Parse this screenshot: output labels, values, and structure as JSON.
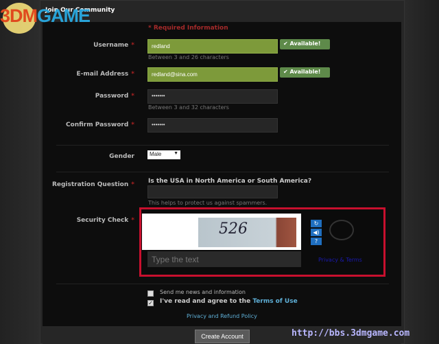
{
  "watermark": {
    "logo": "3DMGAME",
    "url": "http://bbs.3dmgame.com"
  },
  "header": {
    "title": "Join Our Community"
  },
  "required_note": "* Required Information",
  "fields": {
    "username": {
      "label": "Username",
      "value": "redland",
      "hint": "Between 3 and 26 characters",
      "status": "✔ Available!"
    },
    "email": {
      "label": "E-mail Address",
      "value": "redland@sina.com",
      "status": "✔ Available!"
    },
    "password": {
      "label": "Password",
      "value": "•••••••",
      "hint": "Between 3 and 32 characters"
    },
    "confirm": {
      "label": "Confirm Password",
      "value": "•••••••"
    },
    "gender": {
      "label": "Gender",
      "value": "Male"
    },
    "question": {
      "label": "Registration Question",
      "text": "Is the USA in North America or South America?",
      "value": "",
      "hint": "This helps to protect us against spammers."
    },
    "security": {
      "label": "Security Check",
      "captcha": "526",
      "placeholder": "Type the text",
      "privacy": "Privacy & Terms",
      "highlight_color": "#c8102e"
    }
  },
  "asterisk": "*",
  "options": {
    "news": {
      "label": "Send me news and information",
      "checked": false
    },
    "terms": {
      "label": "I've read and agree to the ",
      "link": "Terms of Use",
      "checked": true
    }
  },
  "policy_link": "Privacy and Refund Policy",
  "submit": "Create Account"
}
